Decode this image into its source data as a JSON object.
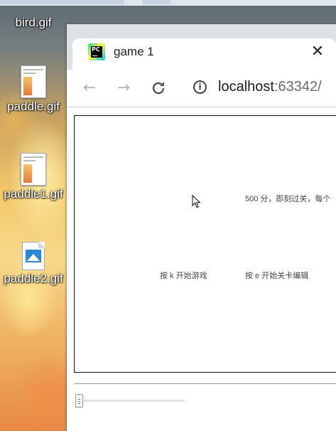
{
  "desktop": {
    "icons": [
      {
        "label": "bird.gif"
      },
      {
        "label": "paddle.gif"
      },
      {
        "label": "paddle1.gif"
      },
      {
        "label": "paddle2.gif"
      }
    ]
  },
  "browser": {
    "tab": {
      "title": "game 1",
      "favicon": "pycharm-icon",
      "favicon_text": "PC",
      "close_icon": "close-icon"
    },
    "toolbar": {
      "back_icon": "arrow-left-icon",
      "forward_icon": "arrow-right-icon",
      "reload_icon": "reload-icon",
      "info_icon": "info-icon",
      "address_host": "localhost",
      "address_port": ":63342/"
    }
  },
  "game": {
    "score_text": "500 分，即刻过关，每个",
    "start_hint": "按 k 开始游戏",
    "edit_hint": "按 e 开始关卡编辑"
  },
  "slider": {
    "value_fraction": 0.0
  }
}
